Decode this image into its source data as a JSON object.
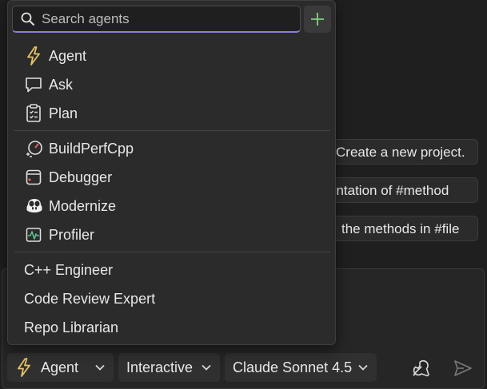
{
  "search": {
    "placeholder": "Search agents",
    "value": ""
  },
  "agents": {
    "builtin": [
      {
        "label": "Agent",
        "icon": "lightning-icon"
      },
      {
        "label": "Ask",
        "icon": "chat-bubble-icon"
      },
      {
        "label": "Plan",
        "icon": "clipboard-checklist-icon"
      }
    ],
    "tools": [
      {
        "label": "BuildPerfCpp",
        "icon": "performance-gauge-icon"
      },
      {
        "label": "Debugger",
        "icon": "debugger-window-icon"
      },
      {
        "label": "Modernize",
        "icon": "copilot-icon"
      },
      {
        "label": "Profiler",
        "icon": "pulse-chart-icon"
      }
    ],
    "custom": [
      {
        "label": "C++ Engineer"
      },
      {
        "label": "Code Review Expert"
      },
      {
        "label": "Repo Librarian"
      }
    ]
  },
  "suggestions": [
    "Create a new project.",
    "entation of #method",
    "the methods in #file"
  ],
  "toolbar": {
    "mode_label": "Agent",
    "interaction_label": "Interactive",
    "model_label": "Claude Sonnet 4.5"
  },
  "colors": {
    "accent_purple": "#8a7fe0",
    "add_green": "#7fd37f",
    "lightning_yellow": "#e8c36a"
  }
}
